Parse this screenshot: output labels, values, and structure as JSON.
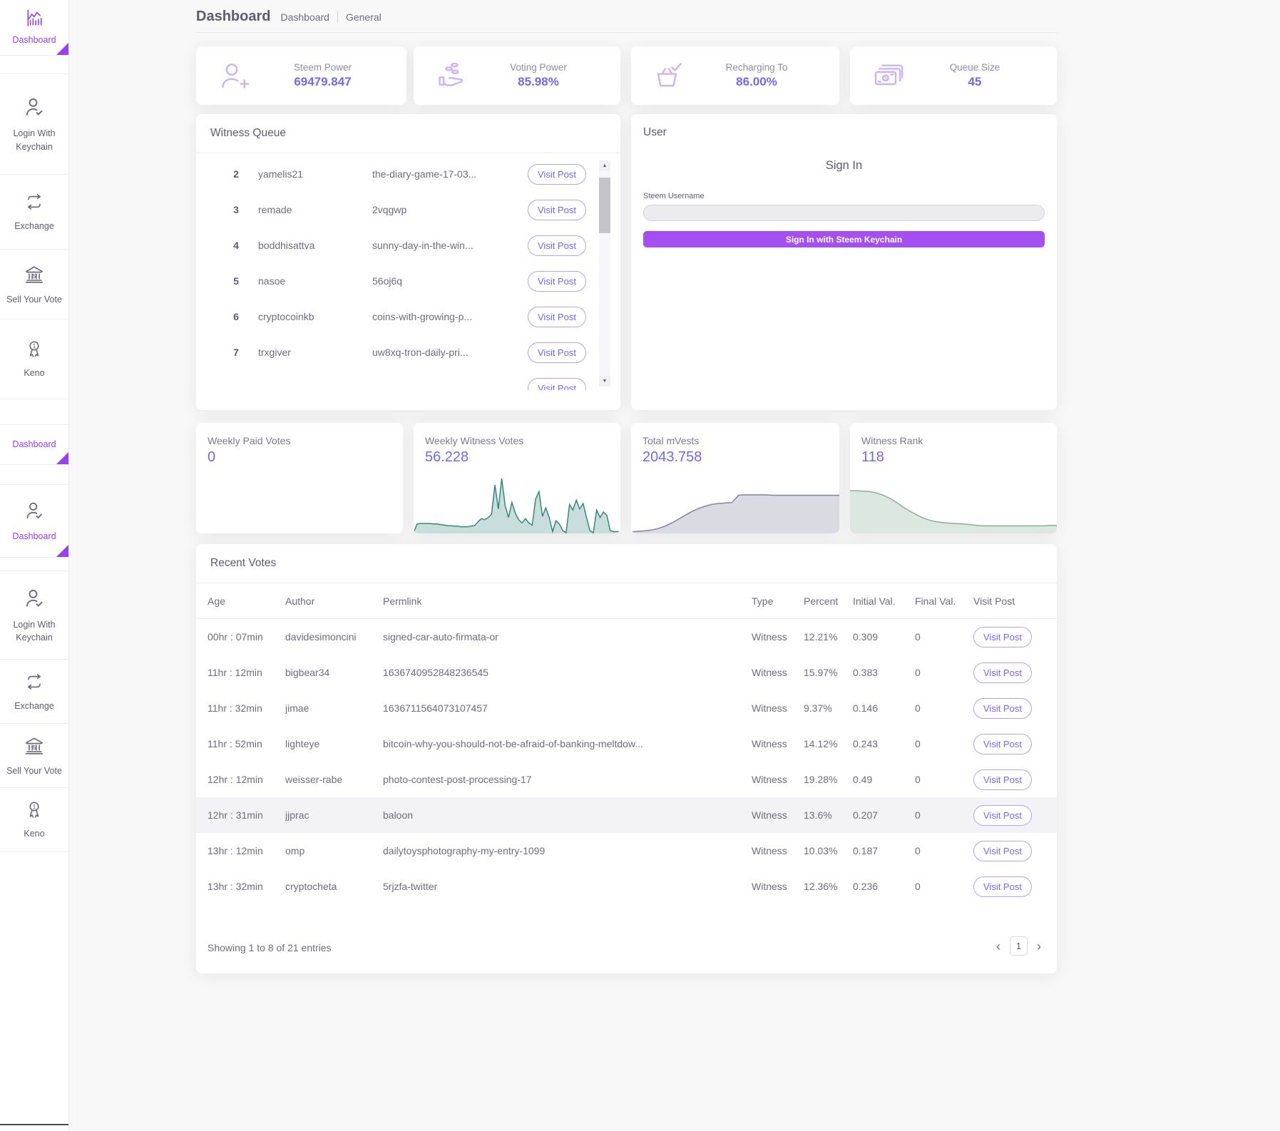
{
  "colors": {
    "accent_purple": "#9b3df0",
    "button_purple": "#a44ff0",
    "value_purple": "#7367f0",
    "heading": "#5e5873",
    "body_text": "#6e6b7b",
    "teal_chart": "#35877c",
    "slate_chart": "#8583a0",
    "green_chart": "#8aae96",
    "page_bg": "#f8f8f8"
  },
  "sidebar": {
    "items": [
      {
        "label": "Dashboard",
        "icon": "bar-chart-icon"
      },
      {
        "label": "Login With Keychain",
        "icon": "user-check-icon"
      },
      {
        "label": "Exchange",
        "icon": "exchange-icon"
      },
      {
        "label": "Sell Your Vote",
        "icon": "bank-icon"
      },
      {
        "label": "Keno",
        "icon": "medal-1-icon"
      },
      {
        "label": "Dashboard"
      },
      {
        "label": "Dashboard",
        "icon": "user-check-icon"
      },
      {
        "label": "Login With Keychain",
        "icon": "user-check-icon"
      },
      {
        "label": "Exchange",
        "icon": "exchange-icon"
      },
      {
        "label": "Sell Your Vote",
        "icon": "bank-icon"
      },
      {
        "label": "Keno",
        "icon": "medal-1-icon"
      }
    ]
  },
  "header": {
    "title": "Dashboard",
    "breadcrumb_1": "Dashboard",
    "breadcrumb_2": "General"
  },
  "stat_cards": [
    {
      "label": "Steem Power",
      "value": "69479.847",
      "icon": "user-plus-icon"
    },
    {
      "label": "Voting Power",
      "value": "85.98%",
      "icon": "hand-coins-icon"
    },
    {
      "label": "Recharging To",
      "value": "86.00%",
      "icon": "basket-check-icon"
    },
    {
      "label": "Queue Size",
      "value": "45",
      "icon": "cash-stack-icon"
    }
  ],
  "witness_queue": {
    "title": "Witness Queue",
    "action_label": "Visit Post",
    "rows": [
      {
        "rank": "2",
        "author": "yamelis21",
        "permlink": "the-diary-game-17-03..."
      },
      {
        "rank": "3",
        "author": "remade",
        "permlink": "2vqgwp"
      },
      {
        "rank": "4",
        "author": "boddhisattva",
        "permlink": "sunny-day-in-the-win..."
      },
      {
        "rank": "5",
        "author": "nasoe",
        "permlink": "56oj6q"
      },
      {
        "rank": "6",
        "author": "cryptocoinkb",
        "permlink": "coins-with-growing-p..."
      },
      {
        "rank": "7",
        "author": "trxgiver",
        "permlink": "uw8xq-tron-daily-pri..."
      }
    ]
  },
  "user_panel": {
    "title": "User",
    "heading": "Sign In",
    "username_label": "Steem Username",
    "username_value": "",
    "submit_label": "Sign In with Steem Keychain"
  },
  "metric_cards": [
    {
      "label": "Weekly Paid Votes",
      "value": "0"
    },
    {
      "label": "Weekly Witness Votes",
      "value": "56.228"
    },
    {
      "label": "Total mVests",
      "value": "2043.758"
    },
    {
      "label": "Witness Rank",
      "value": "118"
    }
  ],
  "chart_data": [
    {
      "type": "area",
      "title": "Weekly Paid Votes sparkline",
      "current_value": 0,
      "ymax": 1,
      "stroke": "#9fb4b0",
      "fill": "none",
      "dash": "2,3",
      "values": [
        0,
        0,
        0,
        0,
        0,
        0,
        0,
        0,
        0,
        0,
        0,
        0,
        0,
        0,
        0,
        0,
        0,
        0,
        0,
        0,
        0,
        0,
        0,
        0,
        0,
        0,
        0,
        0,
        0,
        0,
        0,
        0,
        0,
        0,
        0,
        0,
        0,
        0,
        0,
        0
      ]
    },
    {
      "type": "area",
      "title": "Weekly Witness Votes sparkline",
      "current_value": 56.228,
      "ymax": 100,
      "stroke": "#35877c",
      "fill": "rgba(53,135,124,0.28)",
      "values": [
        0,
        16,
        17,
        17,
        17,
        17,
        16,
        16,
        15,
        14,
        13,
        13,
        12,
        12,
        11,
        11,
        11,
        12,
        13,
        20,
        26,
        24,
        28,
        34,
        88,
        44,
        100,
        50,
        28,
        56,
        36,
        24,
        18,
        26,
        18,
        14,
        62,
        76,
        30,
        46,
        28,
        2,
        22,
        16,
        4,
        0,
        52,
        42,
        60,
        44,
        54,
        28,
        4,
        0,
        42,
        28,
        38,
        32,
        4,
        2,
        2,
        2
      ]
    },
    {
      "type": "area",
      "title": "Total mVests sparkline",
      "current_value": 2043.758,
      "ymax": 100,
      "stroke": "#8583a0",
      "fill": "rgba(133,131,160,0.30)",
      "values": [
        2,
        3,
        4,
        6,
        9,
        14,
        21,
        29,
        38,
        46,
        53,
        58,
        62,
        64,
        65,
        66,
        82,
        83,
        83,
        83,
        83,
        82,
        82,
        82,
        82,
        82,
        82,
        82,
        82,
        82,
        82,
        82
      ]
    },
    {
      "type": "area",
      "title": "Witness Rank sparkline",
      "current_value": 118,
      "ymax": 100,
      "stroke": "#8aae96",
      "fill": "rgba(138,174,150,0.30)",
      "values": [
        92,
        92,
        91,
        90,
        87,
        82,
        75,
        66,
        56,
        47,
        39,
        32,
        27,
        24,
        22,
        21,
        20,
        19,
        18,
        16,
        15,
        15,
        15,
        15,
        15,
        15,
        15,
        15,
        15,
        15,
        16,
        16
      ]
    }
  ],
  "recent_votes": {
    "title": "Recent Votes",
    "action_label": "Visit Post",
    "columns": [
      "Age",
      "Author",
      "Permlink",
      "Type",
      "Percent",
      "Initial Val.",
      "Final Val.",
      "Visit Post"
    ],
    "rows": [
      {
        "age": "00hr : 07min",
        "author": "davidesimoncini",
        "permlink": "signed-car-auto-firmata-or",
        "type": "Witness",
        "percent": "12.21%",
        "initial": "0.309",
        "final": "0"
      },
      {
        "age": "11hr : 12min",
        "author": "bigbear34",
        "permlink": "1636740952848236545",
        "type": "Witness",
        "percent": "15.97%",
        "initial": "0.383",
        "final": "0"
      },
      {
        "age": "11hr : 32min",
        "author": "jimae",
        "permlink": "1636711564073107457",
        "type": "Witness",
        "percent": "9.37%",
        "initial": "0.146",
        "final": "0"
      },
      {
        "age": "11hr : 52min",
        "author": "lighteye",
        "permlink": "bitcoin-why-you-should-not-be-afraid-of-banking-meltdow...",
        "type": "Witness",
        "percent": "14.12%",
        "initial": "0.243",
        "final": "0"
      },
      {
        "age": "12hr : 12min",
        "author": "weisser-rabe",
        "permlink": "photo-contest-post-processing-17",
        "type": "Witness",
        "percent": "19.28%",
        "initial": "0.49",
        "final": "0"
      },
      {
        "age": "12hr : 31min",
        "author": "jjprac",
        "permlink": "baloon",
        "type": "Witness",
        "percent": "13.6%",
        "initial": "0.207",
        "final": "0"
      },
      {
        "age": "13hr : 12min",
        "author": "omp",
        "permlink": "dailytoysphotography-my-entry-1099",
        "type": "Witness",
        "percent": "10.03%",
        "initial": "0.187",
        "final": "0"
      },
      {
        "age": "13hr : 32min",
        "author": "cryptocheta",
        "permlink": "5rjzfa-twitter",
        "type": "Witness",
        "percent": "12.36%",
        "initial": "0.236",
        "final": "0"
      }
    ],
    "footer": "Showing 1 to 8 of 21 entries",
    "pagination": {
      "page": "1"
    }
  }
}
